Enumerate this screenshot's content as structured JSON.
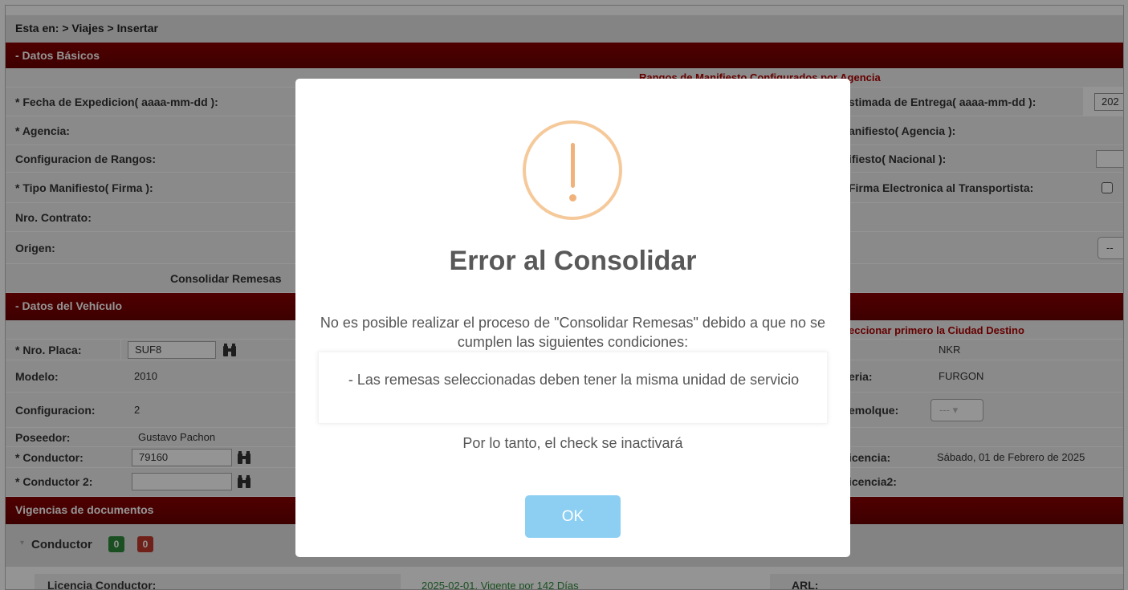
{
  "breadcrumb": "Esta en: > Viajes > Insertar",
  "sections": {
    "datos_basicos": "- Datos Básicos",
    "datos_vehiculo": "- Datos del Vehículo",
    "vigencias": "Vigencias de documentos"
  },
  "basicos": {
    "rangos_notice": "Rangos de Manifiesto Configurados por Agencia",
    "fecha_expedicion_label": "* Fecha de Expedicion( aaaa-mm-dd ):",
    "fecha_entrega_label": "stimada de Entrega( aaaa-mm-dd ):",
    "fecha_entrega_value": "202",
    "agencia_label": "* Agencia:",
    "manifiesto_agencia_label": "anifiesto( Agencia ):",
    "config_rangos_label": "Configuracion de Rangos:",
    "manifiesto_nacional_label": "ifiesto( Nacional ):",
    "tipo_manifiesto_label": "* Tipo Manifiesto( Firma ):",
    "firma_electronica_label": "Firma Electronica al Transportista:",
    "nro_contrato_label": "Nro. Contrato:",
    "origen_label": "Origen:",
    "origen_select_value": "--",
    "consolidar_label": "Consolidar Remesas"
  },
  "vehiculo": {
    "destino_notice": "eccionar primero la Ciudad Destino",
    "placa_label": "* Nro. Placa:",
    "placa_value": "SUF8",
    "marca_value": "NKR",
    "modelo_label": "Modelo:",
    "modelo_value": "2010",
    "carroceria_label": "eria:",
    "carroceria_value": "FURGON",
    "config_label": "Configuracion:",
    "config_value": "2",
    "remolque_label": "emolque:",
    "remolque_select": "---",
    "poseedor_label": "Poseedor:",
    "poseedor_value": "Gustavo Pachon",
    "conductor_label": "* Conductor:",
    "conductor_value": "79160",
    "licencia_label": "icencia:",
    "licencia_value": "Sábado, 01 de Febrero de 2025",
    "conductor2_label": "* Conductor 2:",
    "licencia2_label": "icencia2:"
  },
  "vigencias": {
    "conductor_label": "Conductor",
    "badge_green": "0",
    "badge_red": "0",
    "licencia_conductor_label": "Licencia Conductor:",
    "licencia_conductor_value": "2025-02-01. Vigente por 142 Días",
    "arl_label": "ARL:"
  },
  "modal": {
    "title": "Error al Consolidar",
    "message": "No es posible realizar el proceso de \"Consolidar Remesas\" debido a que no se cumplen las siguientes condiciones:",
    "condition": "- Las remesas seleccionadas deben tener la misma unidad de servicio",
    "footer": "Por lo tanto, el check se inactivará",
    "ok_label": "OK"
  },
  "colors": {
    "section_red": "#7a0000",
    "warning_orange": "#f0b27a",
    "ok_button": "#8ccff2",
    "notice_red": "#b00000",
    "badge_green": "#2e8b3a",
    "badge_red": "#c0392b"
  }
}
